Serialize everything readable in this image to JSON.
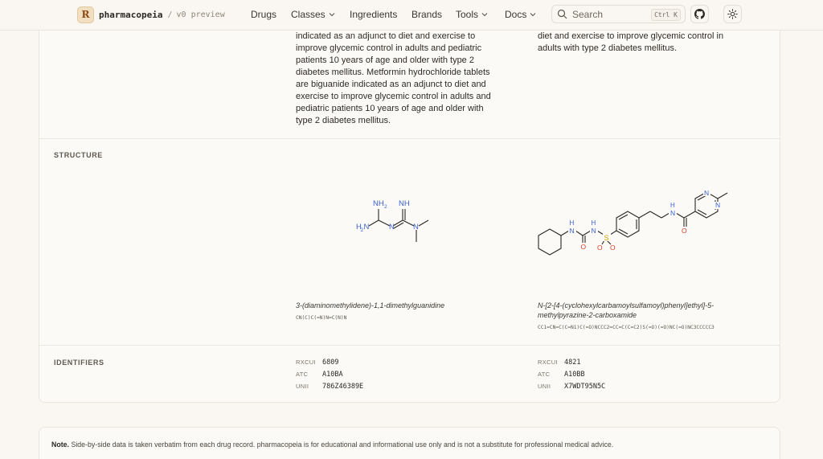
{
  "header": {
    "logo_letter": "R",
    "brand": "pharmacopeia",
    "separator": "/",
    "version": "v0 preview",
    "nav": {
      "drugs": "Drugs",
      "classes": "Classes",
      "ingredients": "Ingredients",
      "brands": "Brands",
      "tools": "Tools",
      "docs": "Docs"
    },
    "search": {
      "placeholder": "Search",
      "shortcut": "Ctrl K"
    }
  },
  "indication": {
    "left": "indicated as an adjunct to diet and exercise to improve glycemic control in adults and pediatric patients 10 years of age and older with type 2 diabetes mellitus. Metformin hydrochloride tablets are biguanide indicated as an adjunct to diet and exercise to improve glycemic control in adults and pediatric patients 10 years of age and older with type 2 diabetes mellitus.",
    "right": "diet and exercise to improve glycemic control in adults with type 2 diabetes mellitus."
  },
  "structure": {
    "label": "STRUCTURE",
    "left": {
      "name": "3-(diaminomethylidene)-1,1-dimethylguanidine",
      "smiles": "CN(C)C(=N)N=C(N)N",
      "atoms": {
        "nh2": "NH",
        "nh2_sub": "2",
        "nh": "NH",
        "h2n": "H",
        "h2n_sub": "2",
        "h2n_n": "N",
        "n_mid": "N",
        "n_dim": "N"
      }
    },
    "right": {
      "name": "N-[2-[4-(cyclohexylcarbamoylsulfamoyl)phenyl]ethyl]-5-methylpyrazine-2-carboxamide",
      "smiles": "CC1=CN=C(C=N1)C(=O)NCCC2=CC=C(C=C2)S(=O)(=O)NC(=O)NC3CCCCC3",
      "atoms": {
        "h": "H",
        "n": "N",
        "s": "S",
        "o": "O"
      }
    }
  },
  "identifiers": {
    "label": "IDENTIFIERS",
    "keys": {
      "rxcui": "RXCUI",
      "atc": "ATC",
      "unii": "UNII"
    },
    "left": {
      "rxcui": "6809",
      "atc": "A10BA",
      "unii": "786Z46389E"
    },
    "right": {
      "rxcui": "4821",
      "atc": "A10BB",
      "unii": "X7WDT95N5C"
    }
  },
  "note": {
    "bold": "Note.",
    "text": "Side-by-side data is taken verbatim from each drug record. pharmacopeia is for educational and informational use only and is not a substitute for professional medical advice."
  },
  "colors": {
    "background": "#faf7f2",
    "nitrogen": "#3b5fd1",
    "oxygen": "#d23c2c",
    "sulfur": "#c9a400",
    "bond": "#2b2722"
  }
}
